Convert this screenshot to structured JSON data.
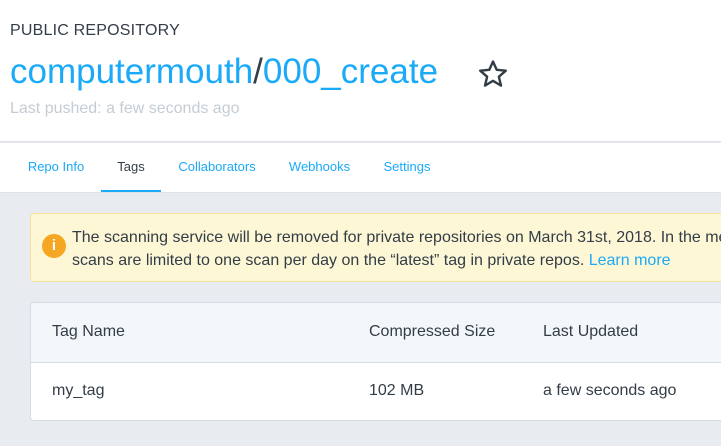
{
  "repo": {
    "visibility": "PUBLIC REPOSITORY",
    "owner": "computermouth",
    "separator": "/",
    "name": "000_create",
    "last_pushed": "Last pushed: a few seconds ago"
  },
  "tabs": [
    {
      "label": "Repo Info",
      "active": false
    },
    {
      "label": "Tags",
      "active": true
    },
    {
      "label": "Collaborators",
      "active": false
    },
    {
      "label": "Webhooks",
      "active": false
    },
    {
      "label": "Settings",
      "active": false
    }
  ],
  "banner": {
    "icon": "warning-info-icon",
    "icon_glyph": "i",
    "line1": "The scanning service will be removed for private repositories on March 31st, 2018. In the me",
    "line2": "scans are limited to one scan per day on the “latest” tag in private repos. ",
    "link_label": "Learn more"
  },
  "table": {
    "headers": [
      "Tag Name",
      "Compressed Size",
      "Last Updated"
    ],
    "rows": [
      [
        "my_tag",
        "102 MB",
        "a few seconds ago"
      ]
    ]
  },
  "colors": {
    "accent": "#1aaaf8",
    "text": "#333d47",
    "muted": "#c4cdd5",
    "warning": "#f5a623",
    "banner_bg": "#fdf7d6",
    "page_bg": "#e8ecf1"
  }
}
